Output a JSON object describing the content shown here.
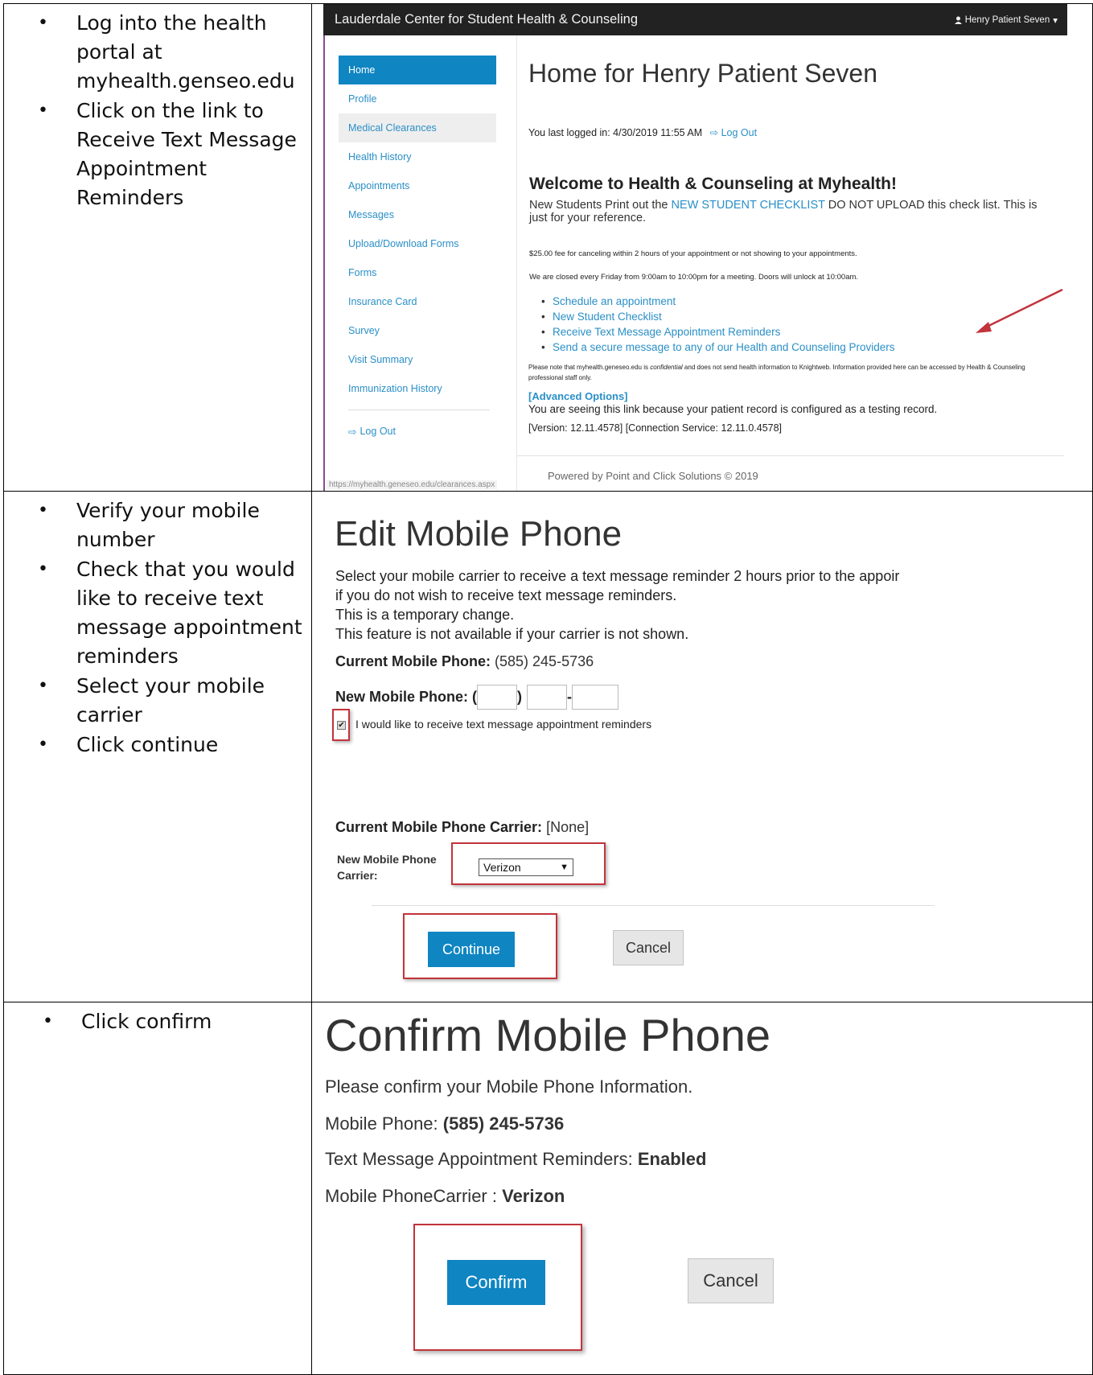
{
  "steps": {
    "row1": [
      "Log into the health portal at myhealth.genseo.edu",
      "Click on the link to Receive Text Message Appointment Reminders"
    ],
    "row2": [
      "Verify your mobile number",
      "Check that you would like to receive text message appointment reminders",
      "Select your mobile carrier",
      "Click continue"
    ],
    "row3": [
      "Click confirm"
    ]
  },
  "portal": {
    "header_title": "Lauderdale Center for Student Health & Counseling",
    "user_menu": "Henry Patient Seven",
    "nav": [
      "Home",
      "Profile",
      "Medical Clearances",
      "Health History",
      "Appointments",
      "Messages",
      "Upload/Download Forms",
      "Forms",
      "Insurance Card",
      "Survey",
      "Visit Summary",
      "Immunization History"
    ],
    "nav_logout": "Log Out",
    "status_url": "https://myhealth.geneseo.edu/clearances.aspx",
    "page_title": "Home for Henry Patient Seven",
    "last_logged_label": "You last logged in: 4/30/2019 11:55 AM",
    "logout_link": "Log Out",
    "welcome": "Welcome to Health & Counseling at Myhealth!",
    "newstudents_pre": "New Students Print out the ",
    "newstudents_link": "NEW STUDENT CHECKLIST",
    "newstudents_post": " DO NOT UPLOAD this check list. This is just for your reference.",
    "fee_text": "$25.00 fee for canceling within 2 hours of your appointment or not showing to your appointments.",
    "closed_text": "We are closed every Friday from 9:00am to 10:00pm for a meeting. Doors will unlock at 10:00am.",
    "links": [
      "Schedule an appointment",
      "New Student Checklist",
      "Receive Text Message Appointment Reminders",
      "Send a secure message to any of our Health and Counseling Providers"
    ],
    "note_pre": "Please note that myhealth.geneseo.edu is ",
    "note_em": "confidential",
    "note_post": " and does not send health information to Knightweb. Information provided here can be accessed by Health & Counseling professional staff only.",
    "advanced": "[Advanced Options]",
    "testing_text": "You are seeing this link because your patient record is configured as a testing record.",
    "version_text": "[Version: 12.11.4578]  [Connection Service: 12.11.0.4578]",
    "powered": "Powered by Point and Click Solutions © 2019",
    "colors": {
      "accent": "#0f85c2",
      "link": "#2a8fc7",
      "topbar": "#222222",
      "highlight": "#c2343b"
    }
  },
  "edit_mobile": {
    "title": "Edit Mobile Phone",
    "desc_lines": [
      "Select your mobile carrier to receive a text message reminder 2 hours prior to the appoir",
      "if you do not wish to receive text message reminders.",
      "This is a temporary change.",
      "This feature is not available if your carrier is not shown."
    ],
    "current_phone_label": "Current Mobile Phone:",
    "current_phone_value": "(585) 245-5736",
    "new_phone_label": "New Mobile Phone: (",
    "paren_close": ")",
    "dash": "-",
    "checkbox_label": "I would like to receive text message appointment reminders",
    "current_carrier_label": "Current Mobile Phone Carrier:",
    "current_carrier_value": "[None]",
    "new_carrier_label_line1": "New Mobile Phone",
    "new_carrier_label_line2": "Carrier:",
    "carrier_selected": "Verizon",
    "continue_label": "Continue",
    "cancel_label": "Cancel"
  },
  "confirm_mobile": {
    "title": "Confirm Mobile Phone",
    "desc": "Please confirm your Mobile Phone Information.",
    "phone_label": "Mobile Phone:",
    "phone_value": "(585) 245-5736",
    "sms_label": "Text Message Appointment Reminders:",
    "sms_value": "Enabled",
    "carrier_label": "Mobile PhoneCarrier :",
    "carrier_value": "Verizon",
    "confirm_label": "Confirm",
    "cancel_label": "Cancel"
  }
}
